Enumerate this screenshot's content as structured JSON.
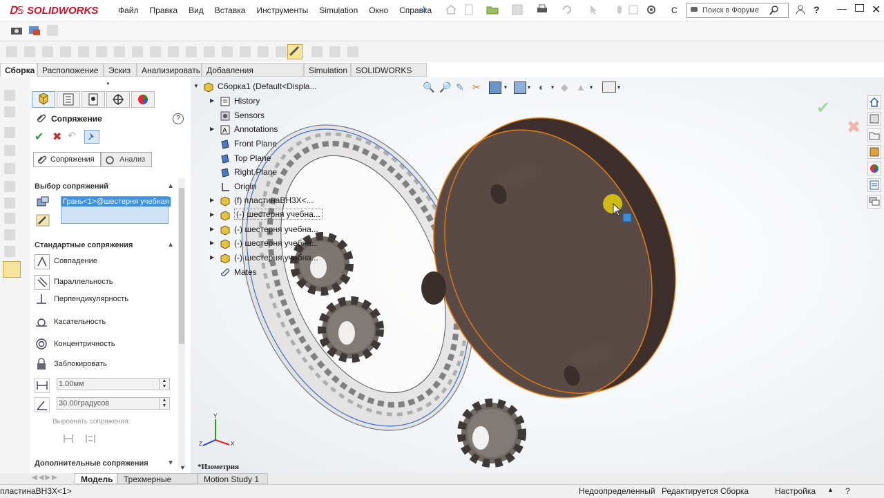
{
  "app": {
    "logo": "SOLIDWORKS"
  },
  "menu": [
    "Файл",
    "Правка",
    "Вид",
    "Вставка",
    "Инструменты",
    "Simulation",
    "Окно",
    "Справка"
  ],
  "search": {
    "placeholder": "Поиск в Форуме"
  },
  "cm_tabs": [
    "Сборка",
    "Расположение",
    "Эскиз",
    "Анализировать",
    "Добавления SOLIDWORKS",
    "Simulation",
    "SOLIDWORKS MBD"
  ],
  "property_manager": {
    "title": "Сопряжение",
    "tabs": {
      "mates": "Сопряжения",
      "analysis": "Анализ"
    },
    "selection": {
      "header": "Выбор сопряжений",
      "value": "Грань<1>@шестерня учебная"
    },
    "standard": {
      "header": "Стандартные сопряжения",
      "items": [
        "Совпадение",
        "Параллельность",
        "Перпендикулярность",
        "Касательность",
        "Концентричность",
        "Заблокировать"
      ],
      "distance": "1.00мм",
      "angle": "30.00градусов",
      "align_label": "Выровнять сопряжения:"
    },
    "advanced": {
      "header": "Дополнительные сопряжения"
    }
  },
  "tree": {
    "root": "Сборка1  (Default<Displa...",
    "items": [
      "History",
      "Sensors",
      "Annotations",
      "Front Plane",
      "Top Plane",
      "Right Plane",
      "Origin",
      "(f) пластинаВН3Х<...",
      "(-) шестерня учебна...",
      "(-) шестерня учебна...",
      "(-) шестерня учебна...",
      "(-) шестерня учебна...",
      "Mates"
    ]
  },
  "viewport": {
    "view_name": "*Изометрия",
    "axes": {
      "x": "X",
      "y": "Y",
      "z": "Z"
    }
  },
  "bottom_tabs": [
    "Модель",
    "Трехмерные виды",
    "Motion Study 1"
  ],
  "status": {
    "selection": "пластинаВН3Х<1>",
    "defined": "Недоопределенный",
    "editing": "Редактируется Сборка",
    "settings": "Настройка"
  },
  "colors": {
    "accent": "#3d8fe0",
    "selection_edge": "#e07b10",
    "disk": "#4a3c38",
    "gear": "#7a716c"
  }
}
